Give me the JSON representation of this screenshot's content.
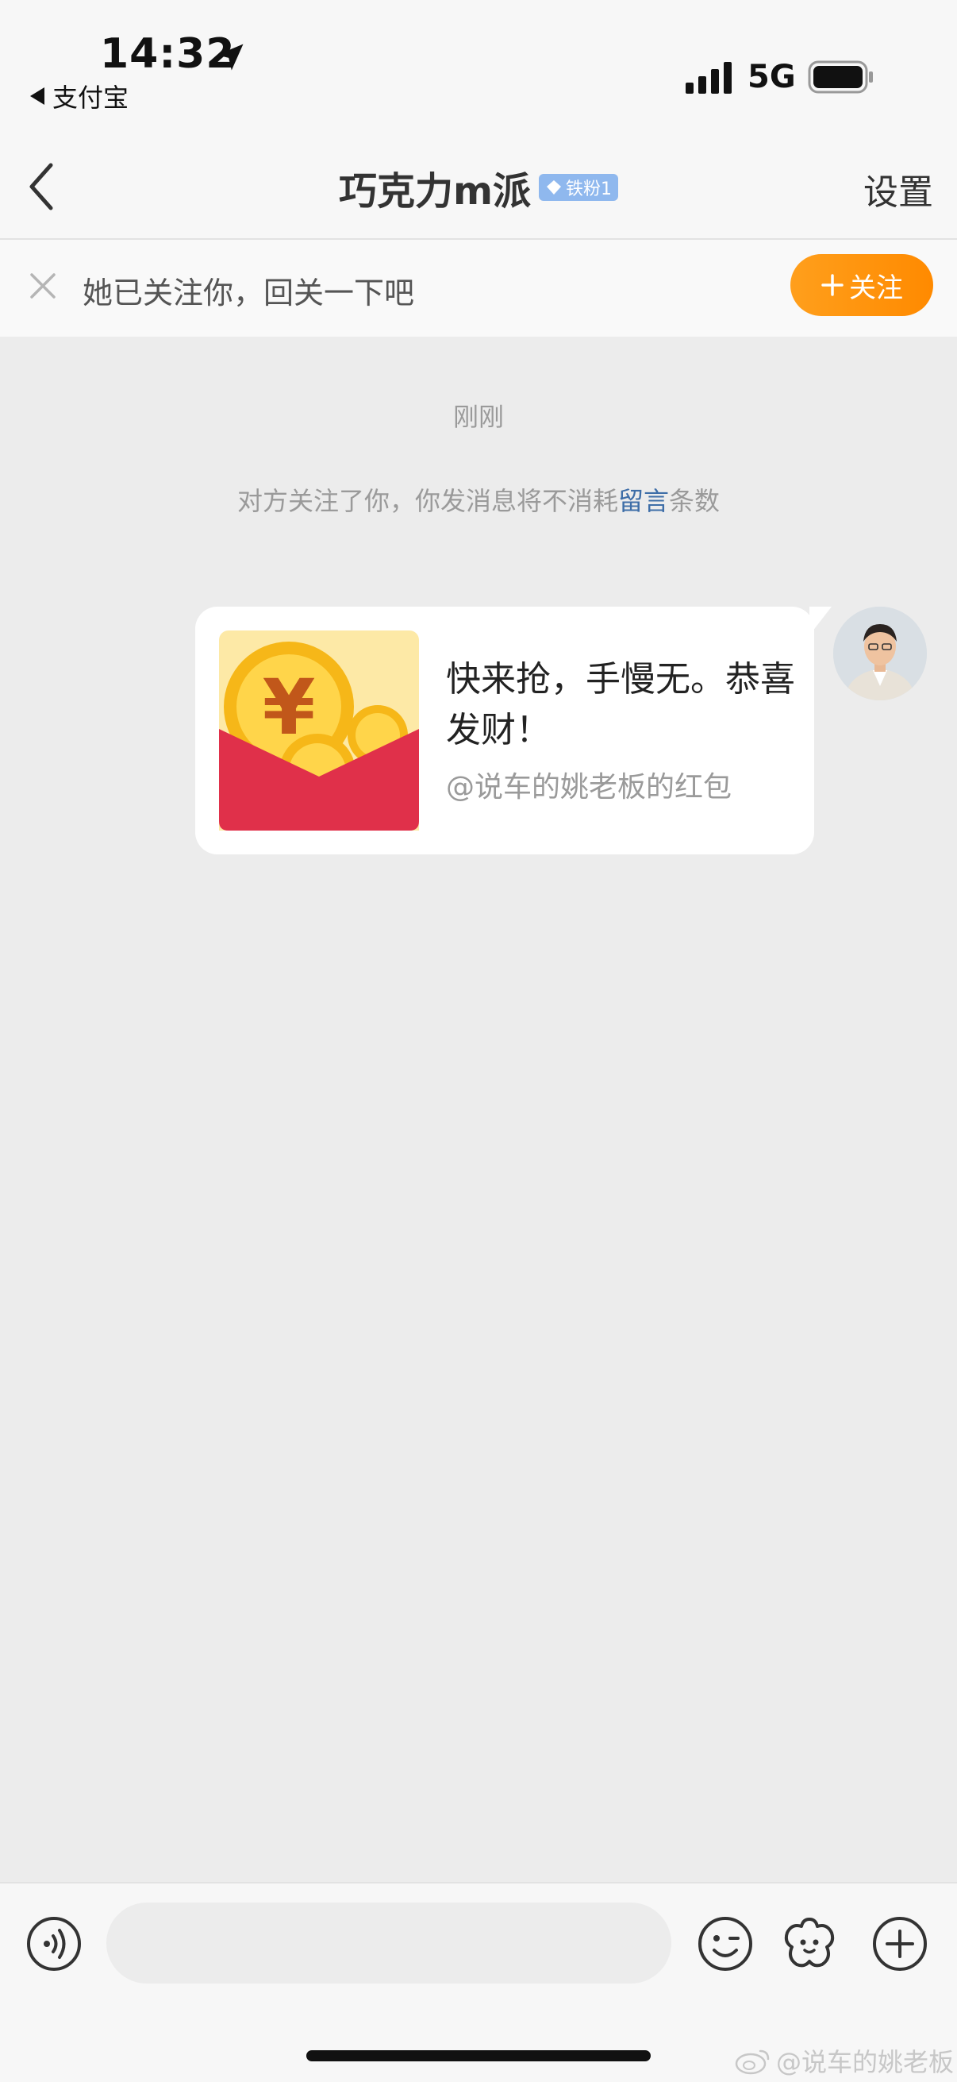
{
  "status_bar": {
    "time": "14:32",
    "back_app": "支付宝",
    "network": "5G"
  },
  "nav": {
    "title": "巧克力m派",
    "badge": "铁粉1",
    "settings": "设置"
  },
  "follow_banner": {
    "text": "她已关注你，回关一下吧",
    "button": "关注"
  },
  "chat": {
    "timestamp": "刚刚",
    "system_prefix": "对方关注了你，你发消息将不消耗",
    "system_highlight": "留言",
    "system_suffix": "条数",
    "message": {
      "title": "快来抢，手慢无。恭喜发财！",
      "subtitle": "@说车的姚老板的红包"
    }
  },
  "input_bar": {
    "icons": [
      "voice-icon",
      "emoji-icon",
      "sticker-icon",
      "plus-icon"
    ]
  },
  "watermark": "@说车的姚老板",
  "colors": {
    "accent_orange": "#ff8a00",
    "link_blue": "#3e6ea8",
    "badge_blue": "#8fb8ee",
    "redpacket_red": "#e0304a"
  }
}
